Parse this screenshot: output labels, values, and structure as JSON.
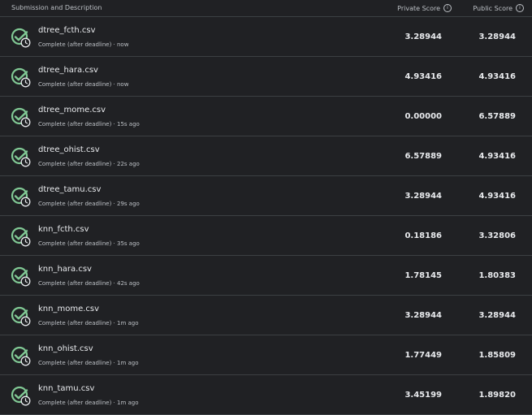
{
  "header": {
    "submission_label": "Submission and Description",
    "private_label": "Private Score",
    "public_label": "Public Score",
    "info_glyph": "i"
  },
  "colors": {
    "success": "#81c995",
    "background": "#202124",
    "border": "#3c4043"
  },
  "rows": [
    {
      "name": "dtree_fcth.csv",
      "status": "Complete (after deadline) · now",
      "private": "3.28944",
      "public": "3.28944"
    },
    {
      "name": "dtree_hara.csv",
      "status": "Complete (after deadline) · now",
      "private": "4.93416",
      "public": "4.93416"
    },
    {
      "name": "dtree_mome.csv",
      "status": "Complete (after deadline) · 15s ago",
      "private": "0.00000",
      "public": "6.57889"
    },
    {
      "name": "dtree_ohist.csv",
      "status": "Complete (after deadline) · 22s ago",
      "private": "6.57889",
      "public": "4.93416"
    },
    {
      "name": "dtree_tamu.csv",
      "status": "Complete (after deadline) · 29s ago",
      "private": "3.28944",
      "public": "4.93416"
    },
    {
      "name": "knn_fcth.csv",
      "status": "Complete (after deadline) · 35s ago",
      "private": "0.18186",
      "public": "3.32806"
    },
    {
      "name": "knn_hara.csv",
      "status": "Complete (after deadline) · 42s ago",
      "private": "1.78145",
      "public": "1.80383"
    },
    {
      "name": "knn_mome.csv",
      "status": "Complete (after deadline) · 1m ago",
      "private": "3.28944",
      "public": "3.28944"
    },
    {
      "name": "knn_ohist.csv",
      "status": "Complete (after deadline) · 1m ago",
      "private": "1.77449",
      "public": "1.85809"
    },
    {
      "name": "knn_tamu.csv",
      "status": "Complete (after deadline) · 1m ago",
      "private": "3.45199",
      "public": "1.89820"
    }
  ]
}
